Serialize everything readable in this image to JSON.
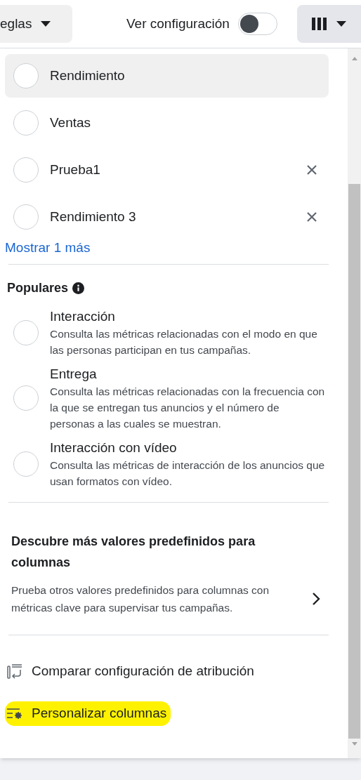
{
  "toolbar": {
    "rules_button": "eglas",
    "settings_label": "Ver configuración",
    "settings_on": false
  },
  "presets": [
    {
      "label": "Rendimiento",
      "highlighted": true,
      "removable": false,
      "selected": false
    },
    {
      "label": "Ventas",
      "highlighted": false,
      "removable": false,
      "selected": false
    },
    {
      "label": "Prueba1",
      "highlighted": false,
      "removable": true,
      "selected": false
    },
    {
      "label": "Rendimiento 3",
      "highlighted": false,
      "removable": true,
      "selected": false
    }
  ],
  "show_more": "Mostrar 1 más",
  "popular": {
    "title": "Populares",
    "items": [
      {
        "title": "Interacción",
        "selected": false,
        "description": "Consulta las métricas relacionadas con el modo en que las personas participan en tus campañas."
      },
      {
        "title": "Entrega",
        "selected": false,
        "description": "Consulta las métricas relacionadas con la frecuencia con la que se entregan tus anuncios y el número de personas a las cuales se muestran."
      },
      {
        "title": "Interacción con vídeo",
        "selected": false,
        "description": "Consulta las métricas de interacción de los anuncios que usan formatos con vídeo."
      }
    ]
  },
  "discover": {
    "title": "Descubre más valores predefinidos para columnas",
    "description": "Prueba otros valores predefinidos para columnas con métricas clave para supervisar tus campañas."
  },
  "actions": [
    {
      "kind": "compare",
      "label": "Comparar configuración de atribución",
      "highlighted": false
    },
    {
      "kind": "customize",
      "label": "Personalizar columnas",
      "highlighted": true
    }
  ]
}
